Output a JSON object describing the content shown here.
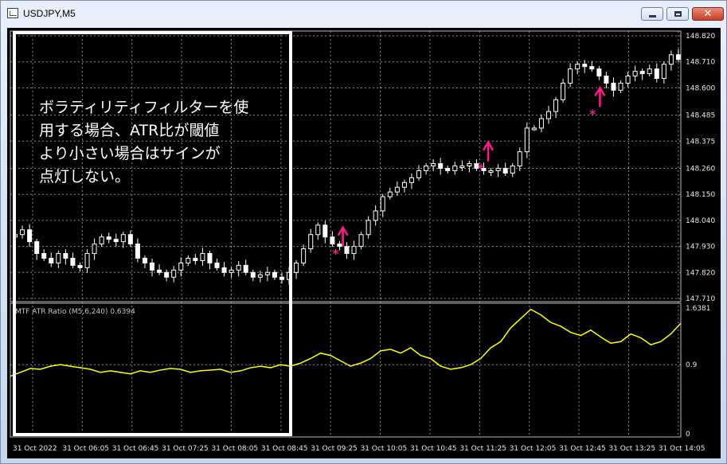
{
  "window": {
    "title": "USDJPY,M5",
    "buttons": {
      "minimize": "minimize",
      "maximize": "maximize",
      "close": "✕"
    }
  },
  "main_chart": {
    "price_ticks": [
      "148.820",
      "148.710",
      "148.600",
      "148.485",
      "148.375",
      "148.260",
      "148.150",
      "148.040",
      "147.930",
      "147.820",
      "147.710"
    ]
  },
  "indicator": {
    "label": "MTF ATR Ratio  (M5,6,240) 0.6394",
    "ticks": [
      "1.6381",
      "0.9",
      "0"
    ]
  },
  "time_axis": {
    "labels": [
      "31 Oct 2022",
      "31 Oct 06:05",
      "31 Oct 06:45",
      "31 Oct 07:25",
      "31 Oct 08:05",
      "31 Oct 08:45",
      "31 Oct 09:25",
      "31 Oct 10:05",
      "31 Oct 10:45",
      "31 Oct 11:25",
      "31 Oct 12:05",
      "31 Oct 12:45",
      "31 Oct 13:25",
      "31 Oct 14:05"
    ]
  },
  "annotation": {
    "text": "ボラティリティフィルターを使\n用する場合、ATR比が閾値\nより小さい場合はサインが\n点灯しない。"
  },
  "colors": {
    "background": "#000000",
    "grid": "#8a8a8a",
    "candle": "#ffffff",
    "indicator_line": "#ffff00",
    "signal": "#ff1a8c",
    "highlight_box": "#ffffff"
  },
  "signals": [
    {
      "type": "buy-arrow",
      "time_index": 88,
      "price": 147.99
    },
    {
      "type": "buy-arrow",
      "time_index": 127,
      "price": 148.35
    },
    {
      "type": "buy-arrow",
      "time_index": 157,
      "price": 148.58
    }
  ],
  "chart_data": {
    "type": "candlestick",
    "symbol": "USDJPY",
    "timeframe": "M5",
    "ylim": [
      147.71,
      148.82
    ],
    "ohlc_close_approx": [
      147.98,
      148.0,
      147.95,
      147.9,
      147.88,
      147.86,
      147.9,
      147.88,
      147.85,
      147.84,
      147.9,
      147.94,
      147.97,
      147.96,
      147.95,
      147.98,
      147.94,
      147.88,
      147.86,
      147.83,
      147.82,
      147.8,
      147.83,
      147.86,
      147.88,
      147.87,
      147.9,
      147.86,
      147.84,
      147.82,
      147.83,
      147.85,
      147.82,
      147.8,
      147.81,
      147.82,
      147.8,
      147.79,
      147.82,
      147.86,
      147.92,
      147.98,
      148.02,
      147.97,
      147.94,
      147.93,
      147.9,
      147.93,
      147.98,
      148.04,
      148.08,
      148.14,
      148.16,
      148.18,
      148.2,
      148.22,
      148.25,
      148.27,
      148.28,
      148.26,
      148.25,
      148.27,
      148.27,
      148.28,
      148.26,
      148.25,
      148.25,
      148.26,
      148.24,
      148.27,
      148.33,
      148.43,
      148.43,
      148.47,
      148.5,
      148.55,
      148.62,
      148.68,
      148.7,
      148.69,
      148.68,
      148.65,
      148.62,
      148.59,
      148.62,
      148.65,
      148.67,
      148.66,
      148.68,
      148.64,
      148.7,
      148.74,
      148.72
    ],
    "indicator": {
      "name": "MTF ATR Ratio",
      "params": "(M5,6,240)",
      "current": 0.6394,
      "ylim": [
        0,
        1.6381
      ],
      "values": [
        0.75,
        0.8,
        0.85,
        0.84,
        0.88,
        0.9,
        0.88,
        0.86,
        0.84,
        0.8,
        0.82,
        0.8,
        0.78,
        0.82,
        0.8,
        0.83,
        0.85,
        0.84,
        0.8,
        0.82,
        0.83,
        0.84,
        0.8,
        0.82,
        0.86,
        0.88,
        0.86,
        0.9,
        0.88,
        0.92,
        0.98,
        1.05,
        1.02,
        0.95,
        0.88,
        0.92,
        0.98,
        1.08,
        1.1,
        1.05,
        1.12,
        1.02,
        0.98,
        0.88,
        0.84,
        0.86,
        0.9,
        0.98,
        1.12,
        1.2,
        1.38,
        1.5,
        1.62,
        1.55,
        1.45,
        1.4,
        1.32,
        1.28,
        1.35,
        1.26,
        1.18,
        1.2,
        1.3,
        1.25,
        1.16,
        1.2,
        1.3,
        1.44
      ]
    }
  }
}
